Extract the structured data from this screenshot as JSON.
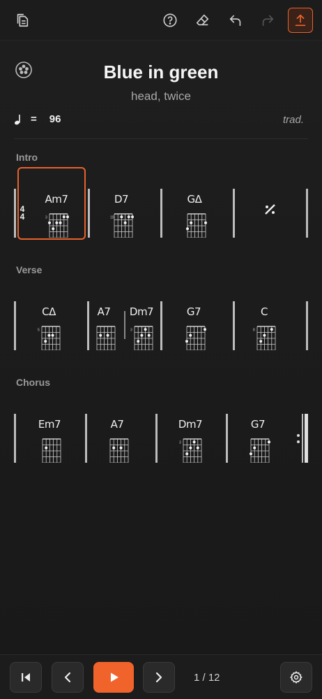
{
  "song": {
    "title": "Blue in green",
    "subtitle": "head, twice",
    "tempo_equals": "=",
    "tempo": "96",
    "composer": "trad."
  },
  "time_signature": {
    "top": "4",
    "bottom": "4"
  },
  "sections": [
    {
      "label": "Intro",
      "chords": [
        "Am7",
        "D7",
        "GΔ"
      ],
      "repeat_symbol": "÷"
    },
    {
      "label": "Verse",
      "chords": [
        "CΔ",
        "A7",
        "Dm7",
        "G7",
        "C"
      ]
    },
    {
      "label": "Chorus",
      "chords": [
        "Em7",
        "A7",
        "Dm7",
        "G7"
      ]
    }
  ],
  "chord_fret_labels": {
    "Am7": "3",
    "D7": "10",
    "GΔ": "",
    "CΔ": "5",
    "A7": "",
    "Dm7": "3",
    "G7": "",
    "C": "8",
    "Em7": ""
  },
  "pagination": {
    "current": "1 / 12"
  },
  "colors": {
    "accent": "#f0642c",
    "background": "#1a1a1a"
  },
  "icons": {
    "top": [
      "file-icon",
      "help-icon",
      "eraser-icon",
      "undo-icon",
      "redo-icon",
      "export-icon"
    ],
    "bottom": [
      "skip-start-icon",
      "previous-icon",
      "play-icon",
      "next-icon",
      "settings-icon"
    ]
  }
}
